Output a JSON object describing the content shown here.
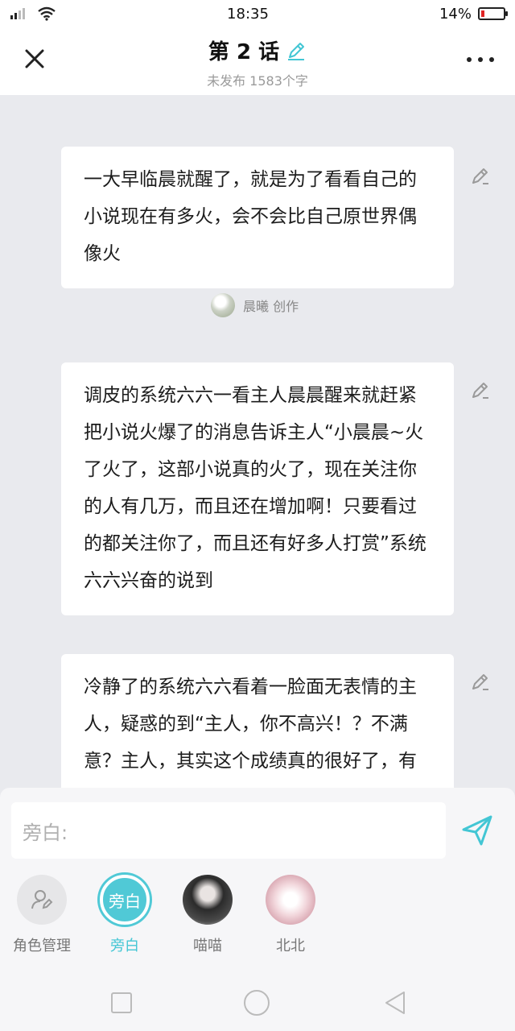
{
  "status_bar": {
    "signal_text": "×",
    "time": "18:35",
    "battery": "14%",
    "battery_level": 0.14,
    "battery_color": "#e02424"
  },
  "header": {
    "title": "第 2 话",
    "subtitle": "未发布 1583个字",
    "icons": {
      "close": "close-icon",
      "title_edit": "pencil-icon",
      "more": "more-icon"
    },
    "accent_color": "#43c6d4"
  },
  "messages": [
    {
      "text": "一大早临晨就醒了，就是为了看看自己的小说现在有多火，会不会比自己原世界偶像火",
      "author": "晨曦 创作"
    },
    {
      "text": "调皮的系统六六一看主人晨晨醒来就赶紧把小说火爆了的消息告诉主人“小晨晨~火了火了，这部小说真的火了，现在关注你的人有几万，而且还在增加啊！只要看过的都关注你了，而且还有好多人打赏”系统六六兴奋的说到"
    },
    {
      "text": "冷静了的系统六六看着一脸面无表情的主人，疑惑的到“主人，你不高兴！？不满意？主人，其实这个成绩真的很好了，有些人的没有这样的成绩呢！”"
    }
  ],
  "composer": {
    "placeholder": "旁白:",
    "send_icon": "send-icon"
  },
  "characters": [
    {
      "label": "角色管理",
      "icon": "user-edit-icon"
    },
    {
      "label": "旁白",
      "avatar_text": "旁白",
      "selected": true
    },
    {
      "label": "喵喵"
    },
    {
      "label": "北北"
    }
  ],
  "nav": {
    "icons": [
      "square-icon",
      "circle-icon",
      "back-triangle-icon"
    ]
  }
}
